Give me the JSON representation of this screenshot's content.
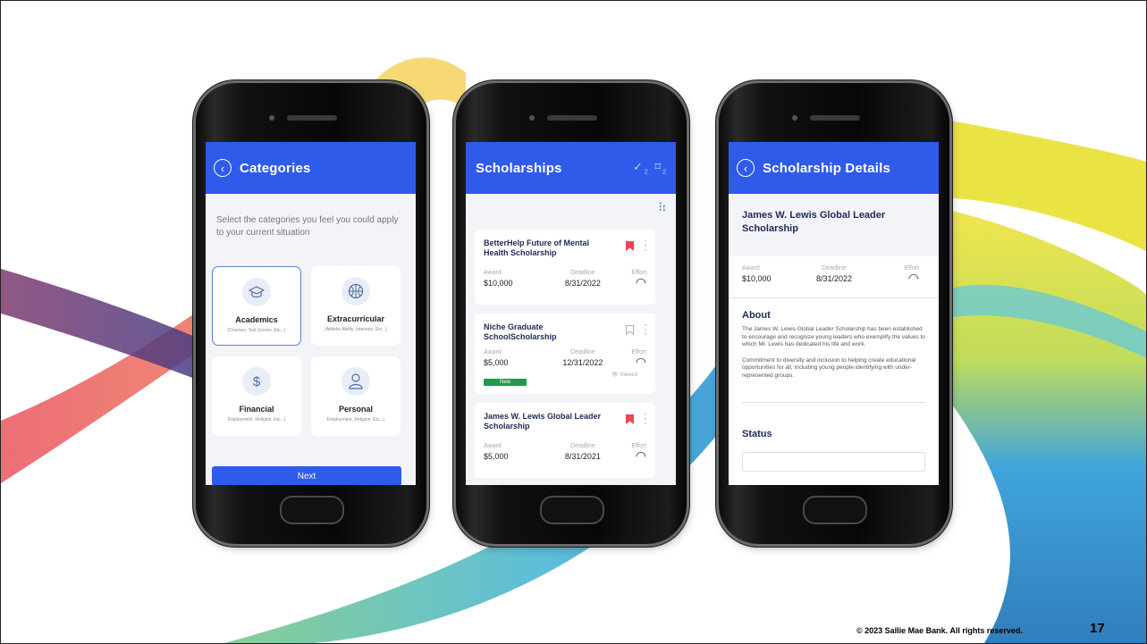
{
  "phone1": {
    "title": "Categories",
    "back_icon": "chevron-left-icon",
    "intro": "Select the categories you feel you could apply to your current situation",
    "categories": [
      {
        "name": "Academics",
        "sub": "(Courses, Test Scores, Etc...)",
        "icon": "graduation-cap-icon",
        "selected": true
      },
      {
        "name": "Extracurricular",
        "sub": "(Athletic Ability, Interests, Etc...)",
        "icon": "basketball-icon",
        "selected": false
      },
      {
        "name": "Financial",
        "sub": "Employment, Religion, Etc...)",
        "icon": "dollar-icon",
        "selected": false
      },
      {
        "name": "Personal",
        "sub": "Employment, Religion, Etc...)",
        "icon": "person-icon",
        "selected": false
      }
    ],
    "next_label": "Next"
  },
  "phone2": {
    "title": "Scholarships",
    "applied_icon": "check-icon",
    "applied_count": "2",
    "saved_icon": "bookmark-icon",
    "saved_count": "2",
    "filter_icon": "sliders-icon",
    "labels": {
      "award": "Award",
      "deadline": "Deadline",
      "effort": "Effort"
    },
    "cards": [
      {
        "title": "BetterHelp Future of Mental Health Scholarship",
        "award": "$10,000",
        "deadline": "8/31/2022",
        "bookmarked": true
      },
      {
        "title": "Niche Graduate SchoolScholarship",
        "award": "$5,000",
        "deadline": "12/31/2022",
        "bookmarked": false,
        "badge": "New",
        "viewed": "Viewed"
      },
      {
        "title": "James W. Lewis Global Leader Scholarship",
        "award": "$5,000",
        "deadline": "8/31/2021",
        "bookmarked": true
      }
    ]
  },
  "phone3": {
    "title": "Scholarship Details",
    "scholarship_title": "James W. Lewis Global Leader Scholarship",
    "labels": {
      "award": "Award",
      "deadline": "Deadline",
      "effort": "Effort"
    },
    "award": "$10,000",
    "deadline": "8/31/2022",
    "about_heading": "About",
    "about_p1": "The James W. Lewis Global Leader Scholarship has been established to encourage and recognize young leaders who exemplify the values to which Mr. Lewis has dedicated his life and work.",
    "about_p2": "Commitment to diversity and inclusion to helping create educational opportunities for all, including young people identifying with under-represented groups.",
    "status_heading": "Status"
  },
  "footer": "© 2023 Sallie Mae Bank. All rights reserved.",
  "page_number": "17",
  "colors": {
    "primary": "#2f5bea",
    "navy": "#1d2a59",
    "bookmark": "#f0445a",
    "new_badge": "#1d9b4f"
  }
}
